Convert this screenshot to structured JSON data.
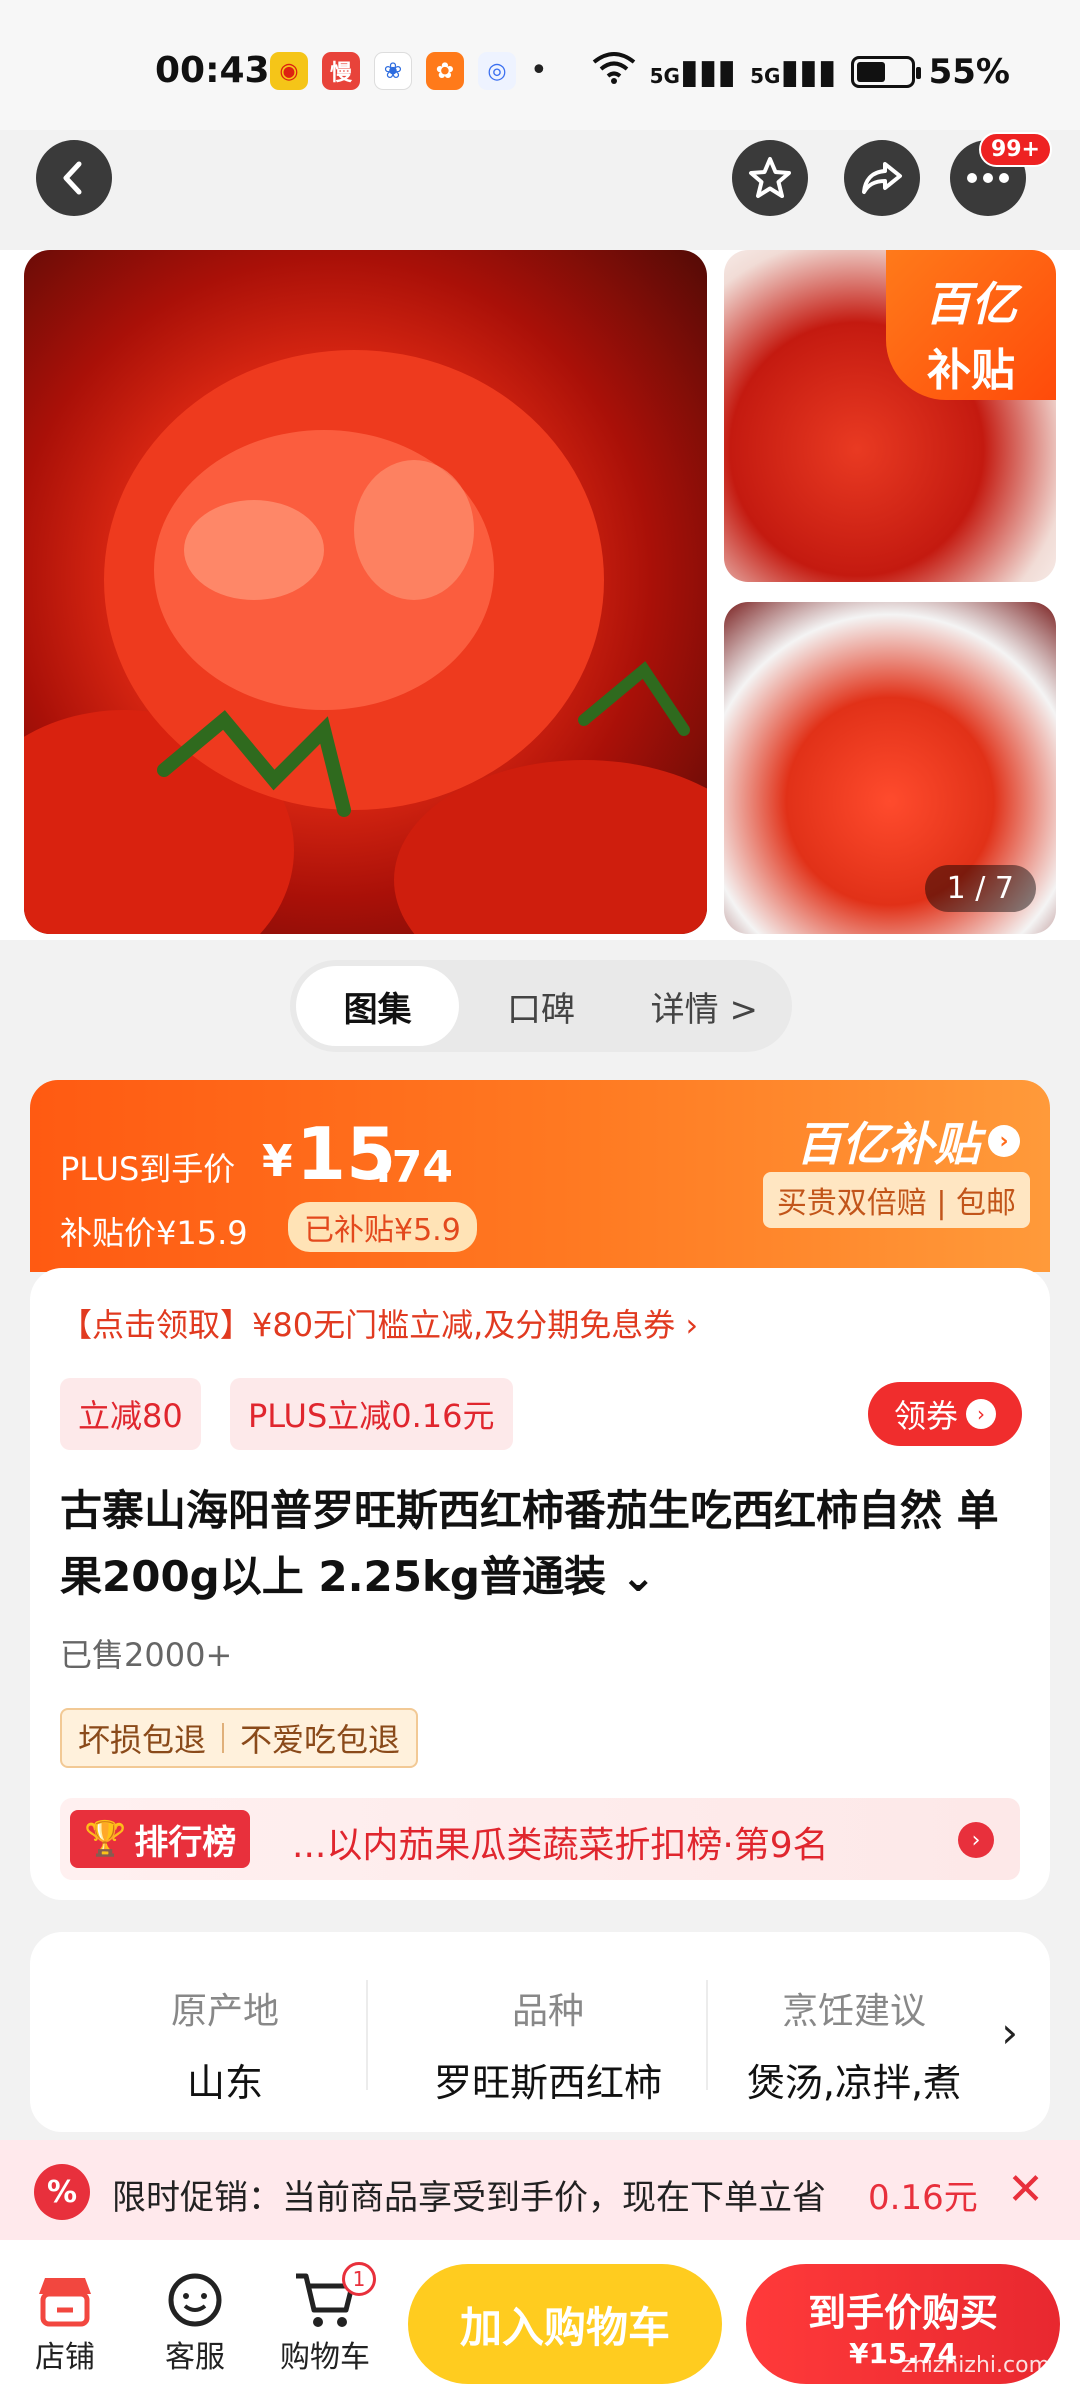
{
  "status": {
    "time": "00:43",
    "apps": [
      "weibo",
      "慢",
      "baidu",
      "orange",
      "search",
      "•"
    ],
    "network1": "5G",
    "network2": "5G",
    "battery": "55%"
  },
  "nav": {
    "more_badge": "99+"
  },
  "gallery": {
    "yi_badge_line1": "百亿",
    "yi_badge_line2": "补贴",
    "counter": "1 / 7"
  },
  "tabs": [
    {
      "label": "图集",
      "active": true
    },
    {
      "label": "口碑",
      "active": false
    },
    {
      "label": "详情 >",
      "active": false
    }
  ],
  "price": {
    "plus_label": "PLUS到手价",
    "currency": "¥",
    "plus_int": "15",
    "plus_dec": ".74",
    "subsidy_price": "补贴价¥15.9",
    "subsidized": "已补贴¥5.9",
    "yi_logo": "百亿补贴",
    "yi_sub": "买贵双倍赔 | 包邮"
  },
  "info": {
    "promo_line": "【点击领取】¥80无门槛立减,及分期免息券 ›",
    "chip1": "立减80",
    "chip2": "PLUS立减0.16元",
    "coupon_btn": "领券",
    "title": "古寨山海阳普罗旺斯西红柿番茄生吃西红柿自然 单果200g以上 2.25kg普通装 ⌄",
    "sold": "已售2000+",
    "guarantee1": "坏损包退",
    "guarantee2": "不爱吃包退",
    "rank_tag": "排行榜",
    "rank_text": "...以内茄果瓜类蔬菜折扣榜·第9名"
  },
  "attributes": [
    {
      "key": "原产地",
      "value": "山东"
    },
    {
      "key": "品种",
      "value": "罗旺斯西红柿"
    },
    {
      "key": "烹饪建议",
      "value": "煲汤,凉拌,煮"
    }
  ],
  "promo_bar": {
    "text": "限时促销：当前商品享受到手价，现在下单立省",
    "amount": "0.16元"
  },
  "bottom": {
    "shop": "店铺",
    "service": "客服",
    "cart": "购物车",
    "cart_count": "1",
    "add_cart": "加入购物车",
    "buy_line1": "到手价购买",
    "buy_line2": "¥15.74",
    "watermark": "zhizhizhi.com"
  },
  "colors": {
    "accent_orange": "#ff6a1a",
    "accent_red": "#e8303c",
    "add_cart_yellow": "#ffcc1f"
  }
}
